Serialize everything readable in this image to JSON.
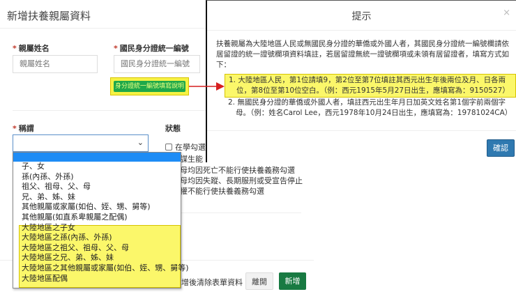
{
  "modal": {
    "title": "新增扶養親屬資料",
    "name_label": "親屬姓名",
    "name_placeholder": "親屬姓名",
    "id_label": "國民身分證統一編號",
    "id_placeholder": "國民身分證統一編號",
    "id_help_button": "身分證統一編號填寫說明",
    "relation_label": "稱謂",
    "relation_options": [
      "",
      "子、女",
      "孫(內孫、外孫)",
      "祖父、祖母、父、母",
      "兄、弟、姊、妹",
      "其他親屬或家屬(如伯、姪、甥、舅等)",
      "其他親屬(如直系卑親屬之配偶)",
      "大陸地區之子女",
      "大陸地區之孫(內孫、外孫)",
      "大陸地區之祖父、祖母、父、母",
      "大陸地區之兄、弟、姊、妹",
      "大陸地區之其他親屬或家屬(如伯、姪、甥、舅等)",
      "大陸地區配偶"
    ],
    "status_label": "狀態",
    "status_lines": [
      "在學勾選",
      "謀生能",
      "母均因死亡不能行使扶養義務勾選",
      "母均因失蹤、長期服刑或受宣告停止",
      "權不能行使扶養義務勾選"
    ],
    "clear_text": "增後清除表單資料",
    "leave_button": "離開",
    "add_button": "新增"
  },
  "hint": {
    "title": "提示",
    "close": "×",
    "intro": "扶養親屬為大陸地區人民或無國民身分證的華僑或外國人者，其國民身分證統一編號欄請依居留證的統一證號欄項資料填註，若居留證無統一證號欄項或未領有居留證者，填寫方式如下：",
    "items": [
      "1. 大陸地區人民，第1位請填9，第2位至第7位填註其西元出生年後兩位及月、日各兩位，第8位至第10位空白。（例：西元1915年5月27日出生，應填寫為：9150527）",
      "2. 無國民身分證的華僑或外國人者，填註西元出生年月日加英文姓名第1個字前兩個字母。（例：姓名Carol Lee，西元1978年10月24日出生，應填寫為：19781024CA）"
    ],
    "ok_button": "確認"
  }
}
